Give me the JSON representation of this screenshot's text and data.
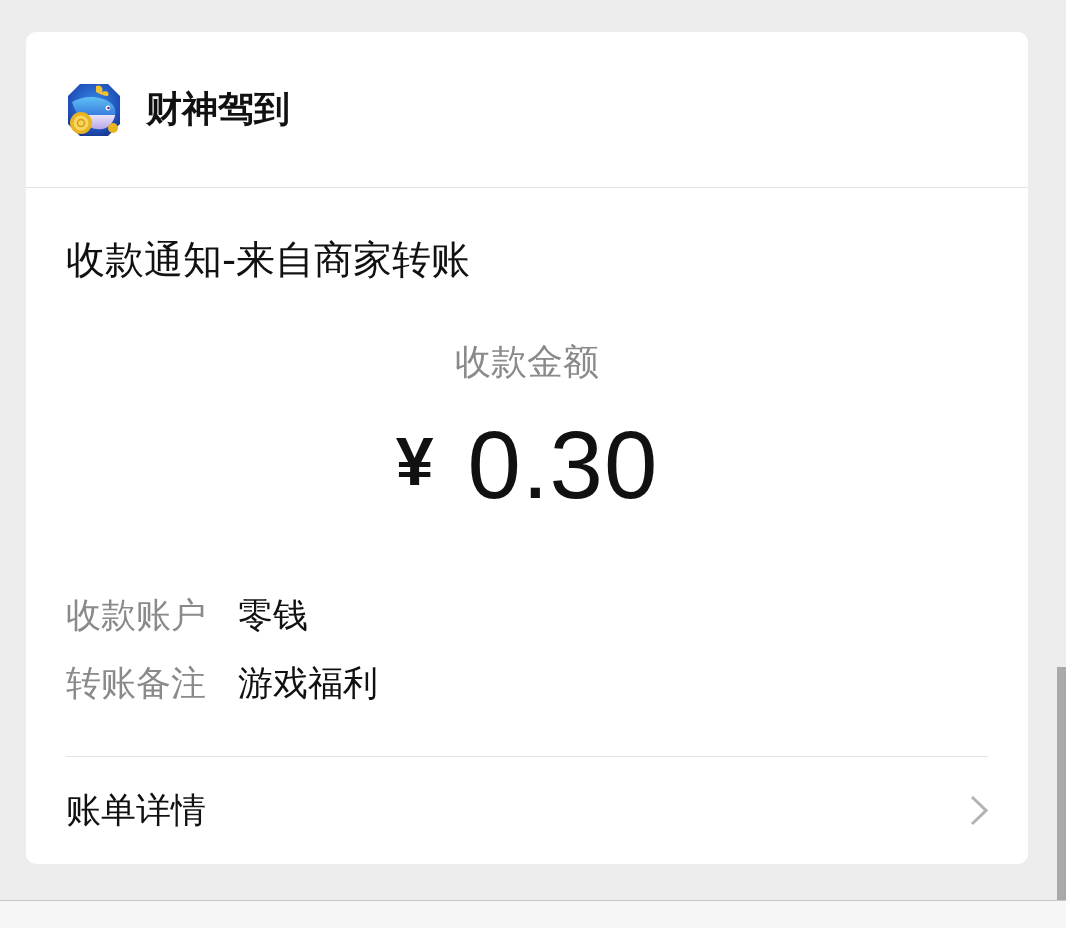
{
  "app": {
    "name": "财神驾到"
  },
  "notice": {
    "title": "收款通知-来自商家转账",
    "amount_label": "收款金额",
    "currency": "¥",
    "amount": "0.30",
    "details": [
      {
        "label": "收款账户",
        "value": "零钱"
      },
      {
        "label": "转账备注",
        "value": "游戏福利"
      }
    ],
    "link": {
      "label": "账单详情"
    }
  }
}
